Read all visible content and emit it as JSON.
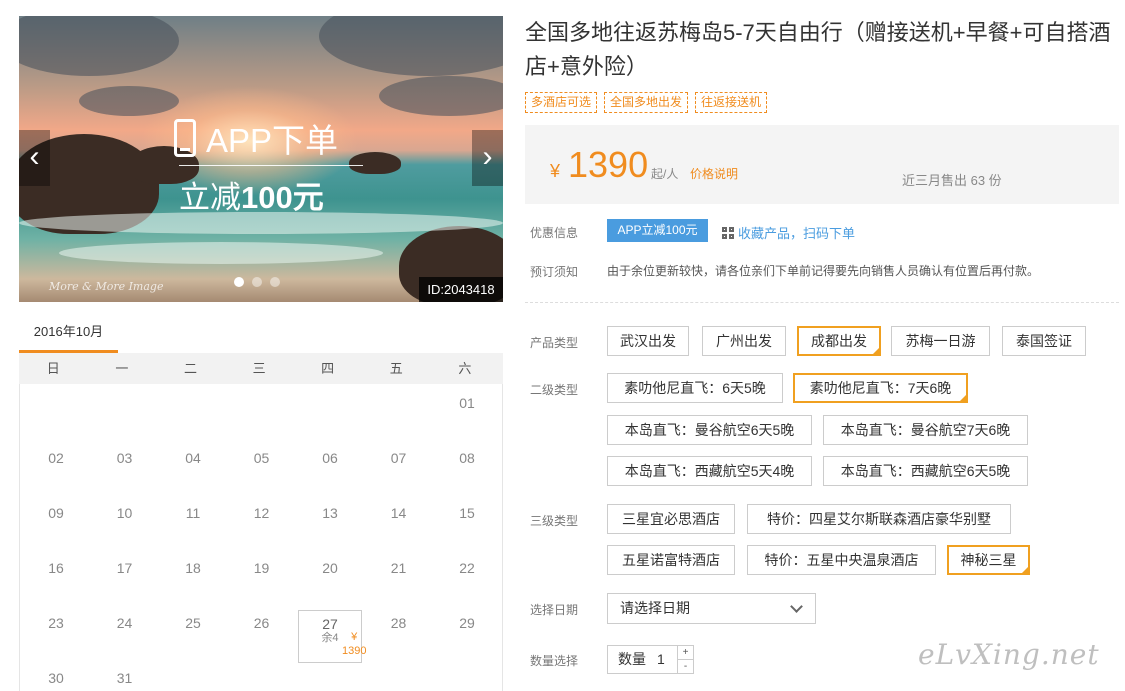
{
  "banner": {
    "headline": "APP下单",
    "sub_prefix": "立减",
    "sub_amount": "100元",
    "photo_watermark": "More & More Image",
    "id_badge": "ID:2043418",
    "prev_glyph": "‹",
    "next_glyph": "›",
    "slide_count": 3,
    "active_slide": 1
  },
  "calendar": {
    "month_tab": "2016年10月",
    "weekdays": [
      "日",
      "一",
      "二",
      "三",
      "四",
      "五",
      "六"
    ],
    "rows": [
      [
        "",
        "",
        "",
        "",
        "",
        "",
        "01"
      ],
      [
        "02",
        "03",
        "04",
        "05",
        "06",
        "07",
        "08"
      ],
      [
        "09",
        "10",
        "11",
        "12",
        "13",
        "14",
        "15"
      ],
      [
        "16",
        "17",
        "18",
        "19",
        "20",
        "21",
        "22"
      ],
      [
        "23",
        "24",
        "25",
        "26",
        "27",
        "28",
        "29"
      ],
      [
        "30",
        "31",
        "",
        "",
        "",
        "",
        ""
      ]
    ],
    "available": {
      "day": "27",
      "price": "¥ 1390",
      "stock": "余4"
    }
  },
  "product": {
    "title": "全国多地往返苏梅岛5-7天自由行（赠接送机+早餐+可自搭酒店+意外险）",
    "tags": [
      "多酒店可选",
      "全国多地出发",
      "往返接送机"
    ],
    "currency": "¥",
    "price": "1390",
    "per": "起/人",
    "price_note": "价格说明",
    "sold": "近三月售出 63 份"
  },
  "promo": {
    "label": "优惠信息",
    "badge": "APP立减100元",
    "qr_text": "收藏产品，扫码下单"
  },
  "booking": {
    "label": "预订须知",
    "text": "由于余位更新较快，请各位亲们下单前记得要先向销售人员确认有位置后再付款。"
  },
  "options": {
    "type_label": "产品类型",
    "types": [
      "武汉出发",
      "广州出发",
      "成都出发",
      "苏梅一日游",
      "泰国签证"
    ],
    "type_selected": 2,
    "sub_label": "二级类型",
    "subs": [
      "素叻他尼直飞：6天5晚",
      "素叻他尼直飞：7天6晚",
      "本岛直飞：曼谷航空6天5晚",
      "本岛直飞：曼谷航空7天6晚",
      "本岛直飞：西藏航空5天4晚",
      "本岛直飞：西藏航空6天5晚"
    ],
    "sub_selected": 1,
    "third_label": "三级类型",
    "thirds": [
      "三星宜必思酒店",
      "特价：四星艾尔斯联森酒店豪华别墅",
      "五星诺富特酒店",
      "特价：五星中央温泉酒店",
      "神秘三星"
    ],
    "third_selected": 4
  },
  "date": {
    "label": "选择日期",
    "placeholder": "请选择日期"
  },
  "quantity": {
    "label": "数量选择",
    "box_label": "数量",
    "value": "1",
    "plus": "+",
    "minus": "-"
  },
  "site_watermark": "eLvXing.net",
  "colors": {
    "accent": "#f08c1f",
    "blue": "#4a9cdf",
    "selected_border": "#f0a020"
  }
}
